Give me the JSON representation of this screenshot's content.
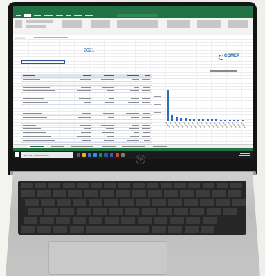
{
  "screen": {
    "year_heading": "2021",
    "brand_logo": "COMEP",
    "search_placeholder": "Scrivi qui il testo da cercare"
  },
  "colors": {
    "excel_green": "#217346",
    "chart_bar": "#2f6db5",
    "total_row_highlight": "#fff200"
  },
  "icons": {
    "start": "windows-logo-icon",
    "brand": "hp-logo-icon"
  },
  "chart_data": {
    "type": "bar",
    "values": [
      100,
      20,
      12,
      10,
      9,
      8,
      7,
      6,
      6,
      5,
      4,
      4,
      3,
      3,
      2,
      2,
      1,
      1
    ],
    "ylim": [
      0,
      110
    ]
  }
}
